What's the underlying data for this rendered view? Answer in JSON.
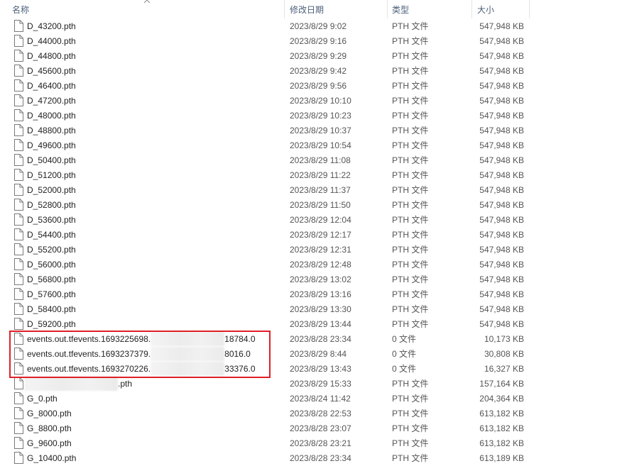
{
  "columns": {
    "name": "名称",
    "modified": "修改日期",
    "type": "类型",
    "size": "大小"
  },
  "files": [
    {
      "name": "D_43200.pth",
      "modified": "2023/8/29 9:02",
      "type": "PTH 文件",
      "size": "547,948 KB"
    },
    {
      "name": "D_44000.pth",
      "modified": "2023/8/29 9:16",
      "type": "PTH 文件",
      "size": "547,948 KB"
    },
    {
      "name": "D_44800.pth",
      "modified": "2023/8/29 9:29",
      "type": "PTH 文件",
      "size": "547,948 KB"
    },
    {
      "name": "D_45600.pth",
      "modified": "2023/8/29 9:42",
      "type": "PTH 文件",
      "size": "547,948 KB"
    },
    {
      "name": "D_46400.pth",
      "modified": "2023/8/29 9:56",
      "type": "PTH 文件",
      "size": "547,948 KB"
    },
    {
      "name": "D_47200.pth",
      "modified": "2023/8/29 10:10",
      "type": "PTH 文件",
      "size": "547,948 KB"
    },
    {
      "name": "D_48000.pth",
      "modified": "2023/8/29 10:23",
      "type": "PTH 文件",
      "size": "547,948 KB"
    },
    {
      "name": "D_48800.pth",
      "modified": "2023/8/29 10:37",
      "type": "PTH 文件",
      "size": "547,948 KB"
    },
    {
      "name": "D_49600.pth",
      "modified": "2023/8/29 10:54",
      "type": "PTH 文件",
      "size": "547,948 KB"
    },
    {
      "name": "D_50400.pth",
      "modified": "2023/8/29 11:08",
      "type": "PTH 文件",
      "size": "547,948 KB"
    },
    {
      "name": "D_51200.pth",
      "modified": "2023/8/29 11:22",
      "type": "PTH 文件",
      "size": "547,948 KB"
    },
    {
      "name": "D_52000.pth",
      "modified": "2023/8/29 11:37",
      "type": "PTH 文件",
      "size": "547,948 KB"
    },
    {
      "name": "D_52800.pth",
      "modified": "2023/8/29 11:50",
      "type": "PTH 文件",
      "size": "547,948 KB"
    },
    {
      "name": "D_53600.pth",
      "modified": "2023/8/29 12:04",
      "type": "PTH 文件",
      "size": "547,948 KB"
    },
    {
      "name": "D_54400.pth",
      "modified": "2023/8/29 12:17",
      "type": "PTH 文件",
      "size": "547,948 KB"
    },
    {
      "name": "D_55200.pth",
      "modified": "2023/8/29 12:31",
      "type": "PTH 文件",
      "size": "547,948 KB"
    },
    {
      "name": "D_56000.pth",
      "modified": "2023/8/29 12:48",
      "type": "PTH 文件",
      "size": "547,948 KB"
    },
    {
      "name": "D_56800.pth",
      "modified": "2023/8/29 13:02",
      "type": "PTH 文件",
      "size": "547,948 KB"
    },
    {
      "name": "D_57600.pth",
      "modified": "2023/8/29 13:16",
      "type": "PTH 文件",
      "size": "547,948 KB"
    },
    {
      "name": "D_58400.pth",
      "modified": "2023/8/29 13:30",
      "type": "PTH 文件",
      "size": "547,948 KB"
    },
    {
      "name": "D_59200.pth",
      "modified": "2023/8/29 13:44",
      "type": "PTH 文件",
      "size": "547,948 KB"
    },
    {
      "name": "events.out.tfevents.1693225698.",
      "name_suffix": "18784.0",
      "redacted": true,
      "modified": "2023/8/28 23:34",
      "type": "0 文件",
      "size": "10,173 KB"
    },
    {
      "name": "events.out.tfevents.1693237379.",
      "name_suffix": "8016.0",
      "redacted": true,
      "modified": "2023/8/29 8:44",
      "type": "0 文件",
      "size": "30,808 KB"
    },
    {
      "name": "events.out.tfevents.1693270226.",
      "name_suffix": "33376.0",
      "redacted": true,
      "modified": "2023/8/29 13:43",
      "type": "0 文件",
      "size": "16,327 KB"
    },
    {
      "name": "",
      "name_suffix": ".pth",
      "redacted": true,
      "modified": "2023/8/29 15:33",
      "type": "PTH 文件",
      "size": "157,164 KB"
    },
    {
      "name": "G_0.pth",
      "modified": "2023/8/24 11:42",
      "type": "PTH 文件",
      "size": "204,364 KB"
    },
    {
      "name": "G_8000.pth",
      "modified": "2023/8/28 22:53",
      "type": "PTH 文件",
      "size": "613,182 KB"
    },
    {
      "name": "G_8800.pth",
      "modified": "2023/8/28 23:07",
      "type": "PTH 文件",
      "size": "613,182 KB"
    },
    {
      "name": "G_9600.pth",
      "modified": "2023/8/28 23:21",
      "type": "PTH 文件",
      "size": "613,182 KB"
    },
    {
      "name": "G_10400.pth",
      "modified": "2023/8/28 23:34",
      "type": "PTH 文件",
      "size": "613,189 KB"
    }
  ],
  "colors": {
    "highlight_border": "#e01f26",
    "header_text": "#4c607a"
  }
}
